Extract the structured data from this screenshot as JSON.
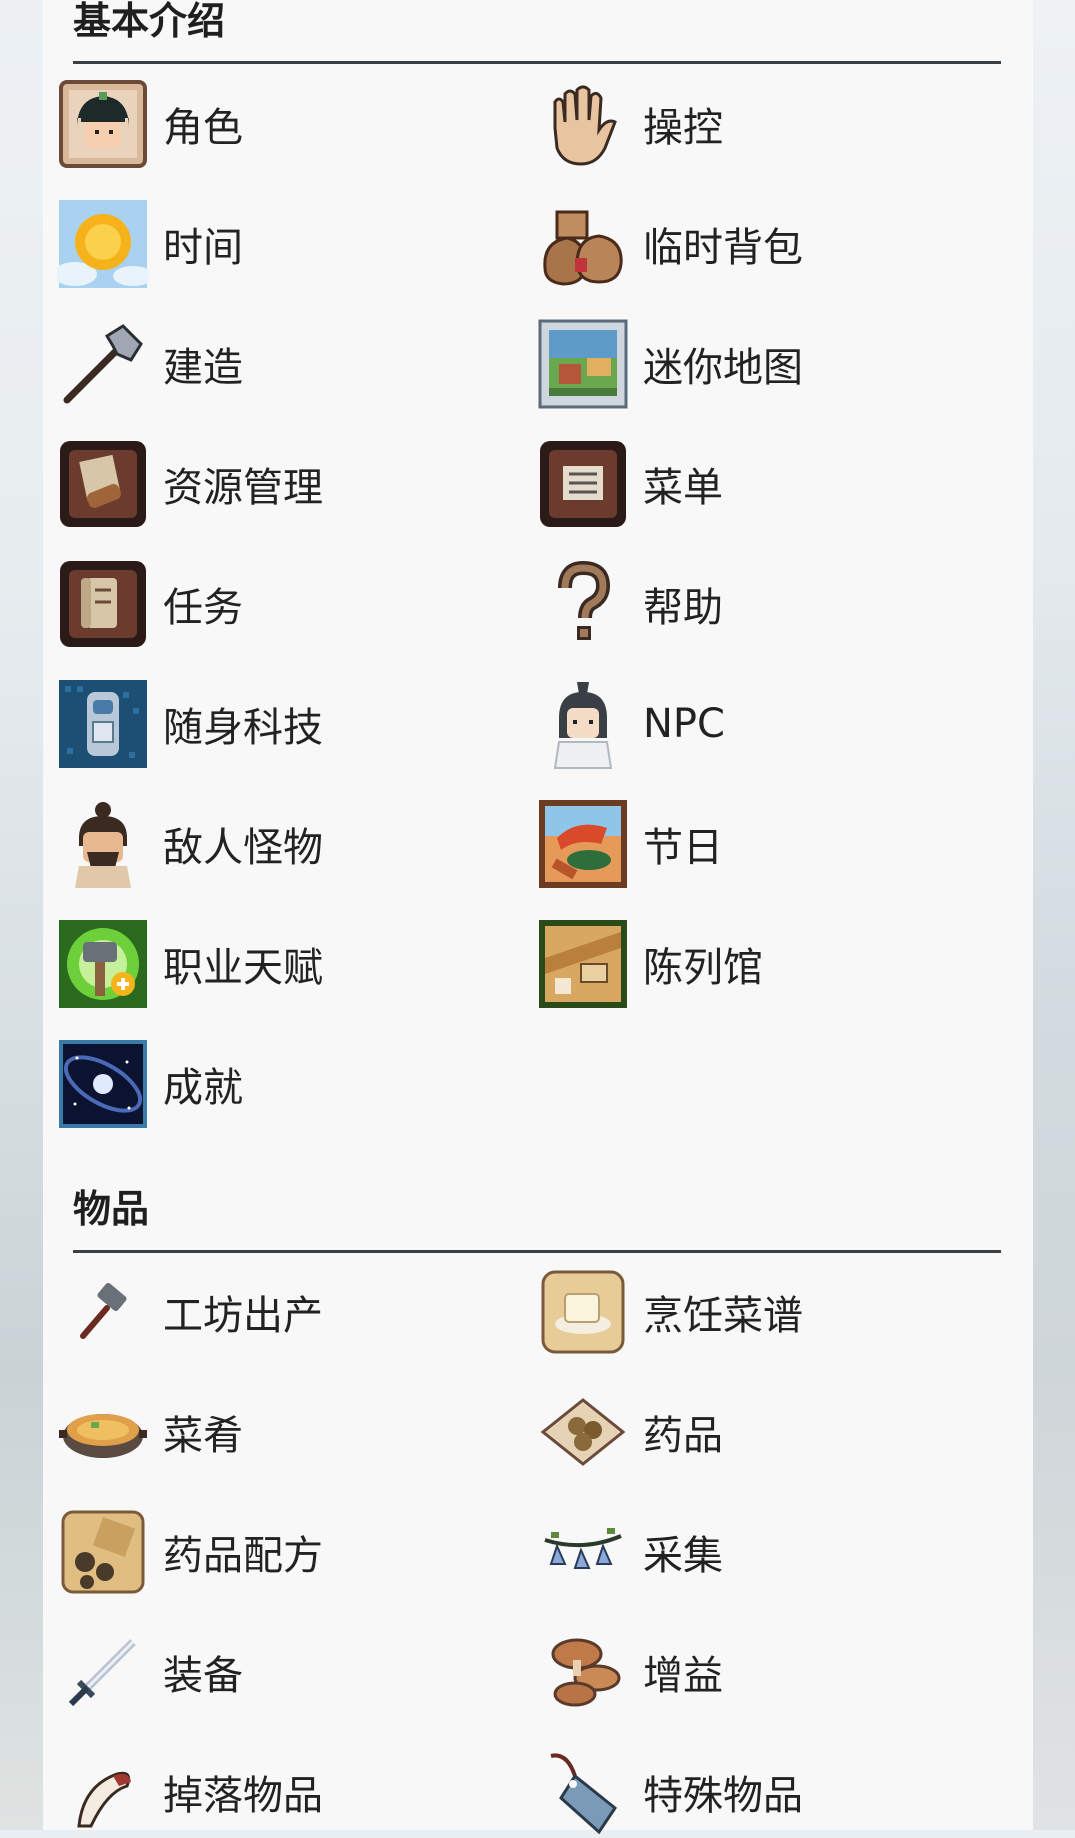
{
  "sections": [
    {
      "title": "基本介绍",
      "items": [
        {
          "label": "角色",
          "icon": "character-portrait-icon"
        },
        {
          "label": "操控",
          "icon": "hand-icon"
        },
        {
          "label": "时间",
          "icon": "sun-sky-icon"
        },
        {
          "label": "临时背包",
          "icon": "bags-icon"
        },
        {
          "label": "建造",
          "icon": "hammer-tool-icon"
        },
        {
          "label": "迷你地图",
          "icon": "minimap-painting-icon"
        },
        {
          "label": "资源管理",
          "icon": "resource-management-icon"
        },
        {
          "label": "菜单",
          "icon": "menu-book-icon"
        },
        {
          "label": "任务",
          "icon": "quest-scroll-icon"
        },
        {
          "label": "帮助",
          "icon": "question-mark-icon"
        },
        {
          "label": "随身科技",
          "icon": "portable-tech-icon"
        },
        {
          "label": "NPC",
          "icon": "npc-character-icon"
        },
        {
          "label": "敌人怪物",
          "icon": "enemy-monster-icon"
        },
        {
          "label": "节日",
          "icon": "festival-painting-icon"
        },
        {
          "label": "职业天赋",
          "icon": "talent-hammer-icon"
        },
        {
          "label": "陈列馆",
          "icon": "gallery-icon"
        },
        {
          "label": "成就",
          "icon": "galaxy-achievement-icon"
        }
      ]
    },
    {
      "title": "物品",
      "items": [
        {
          "label": "工坊出产",
          "icon": "workshop-hammer-icon"
        },
        {
          "label": "烹饪菜谱",
          "icon": "recipe-tofu-icon"
        },
        {
          "label": "菜肴",
          "icon": "dish-pot-icon"
        },
        {
          "label": "药品",
          "icon": "medicine-pills-icon"
        },
        {
          "label": "药品配方",
          "icon": "medicine-recipe-icon"
        },
        {
          "label": "采集",
          "icon": "gathering-bells-icon"
        },
        {
          "label": "装备",
          "icon": "sword-icon"
        },
        {
          "label": "增益",
          "icon": "mushroom-buff-icon"
        },
        {
          "label": "掉落物品",
          "icon": "feather-drop-icon"
        },
        {
          "label": "特殊物品",
          "icon": "tag-special-icon"
        }
      ]
    }
  ],
  "colors": {
    "panel": "#f8f8f8",
    "divider": "#3a3f45",
    "text": "#222222"
  }
}
